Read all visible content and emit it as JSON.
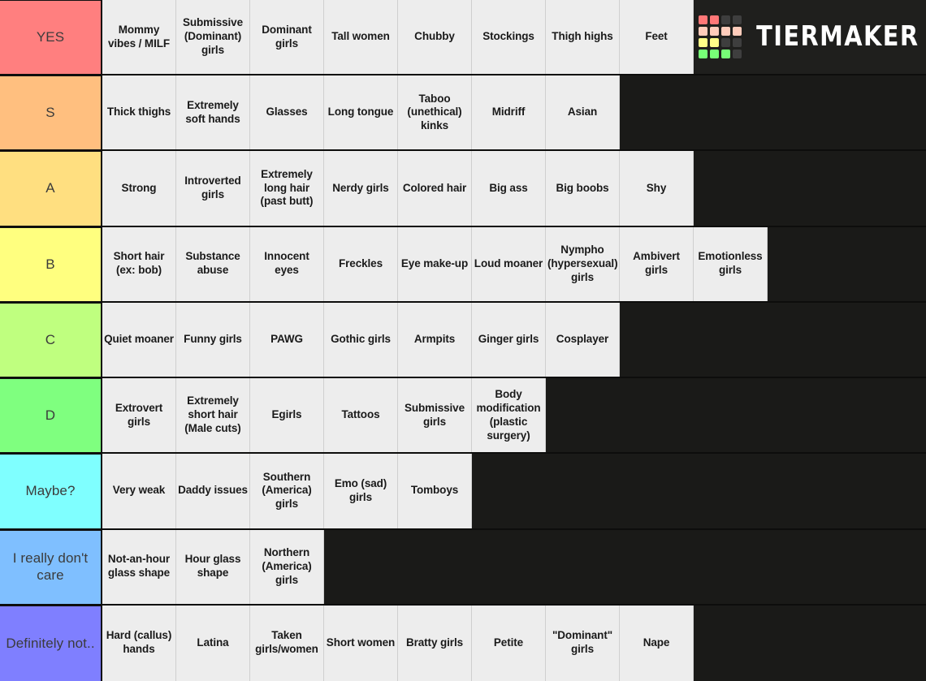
{
  "app": {
    "name": "TierMaker",
    "logo_text": "TiERMAKER",
    "background_color": "#1a1a18",
    "item_bg_color": "#ededed",
    "logo_grid_colors": [
      "#f77",
      "#f77",
      "#3e3e3e",
      "#3e3e3e",
      "#fcb",
      "#fcb",
      "#fcb",
      "#fcb",
      "#ff8",
      "#ff8",
      "#3e3e3e",
      "#3e3e3e",
      "#7f7",
      "#7f7",
      "#7f7",
      "#3e3e3e"
    ]
  },
  "tiers": [
    {
      "label": "YES",
      "color": "#ff7f7f",
      "items": [
        "Mommy vibes / MILF",
        "Submissive (Dominant) girls",
        "Dominant girls",
        "Tall women",
        "Chubby",
        "Stockings",
        "Thigh highs",
        "Feet"
      ]
    },
    {
      "label": "S",
      "color": "#ffbf7f",
      "items": [
        "Thick thighs",
        "Extremely soft hands",
        "Glasses",
        "Long tongue",
        "Taboo (unethical) kinks",
        "Midriff",
        "Asian"
      ]
    },
    {
      "label": "A",
      "color": "#ffdf80",
      "items": [
        "Strong",
        "Introverted girls",
        "Extremely long hair (past butt)",
        "Nerdy girls",
        "Colored hair",
        "Big ass",
        "Big boobs",
        "Shy"
      ]
    },
    {
      "label": "B",
      "color": "#ffff7f",
      "items": [
        "Short hair (ex: bob)",
        "Substance abuse",
        "Innocent eyes",
        "Freckles",
        "Eye make-up",
        "Loud moaner",
        "Nympho (hypersexual) girls",
        "Ambivert girls",
        "Emotionless girls"
      ]
    },
    {
      "label": "C",
      "color": "#bfff7f",
      "items": [
        "Quiet moaner",
        "Funny girls",
        "PAWG",
        "Gothic girls",
        "Armpits",
        "Ginger girls",
        "Cosplayer"
      ]
    },
    {
      "label": "D",
      "color": "#7fff7f",
      "items": [
        "Extrovert girls",
        "Extremely short hair (Male cuts)",
        "Egirls",
        "Tattoos",
        "Submissive girls",
        "Body modification (plastic surgery)"
      ]
    },
    {
      "label": "Maybe?",
      "color": "#7fffff",
      "items": [
        "Very weak",
        "Daddy issues",
        "Southern (America) girls",
        "Emo (sad) girls",
        "Tomboys"
      ]
    },
    {
      "label": "I really don't care",
      "color": "#7fbfff",
      "items": [
        "Not-an-hour glass shape",
        "Hour glass shape",
        "Northern (America) girls"
      ]
    },
    {
      "label": "Definitely not..",
      "color": "#7f7fff",
      "items": [
        "Hard (callus) hands",
        "Latina",
        "Taken girls/women",
        "Short women",
        "Bratty girls",
        "Petite",
        "\"Dominant\" girls",
        "Nape"
      ]
    }
  ]
}
